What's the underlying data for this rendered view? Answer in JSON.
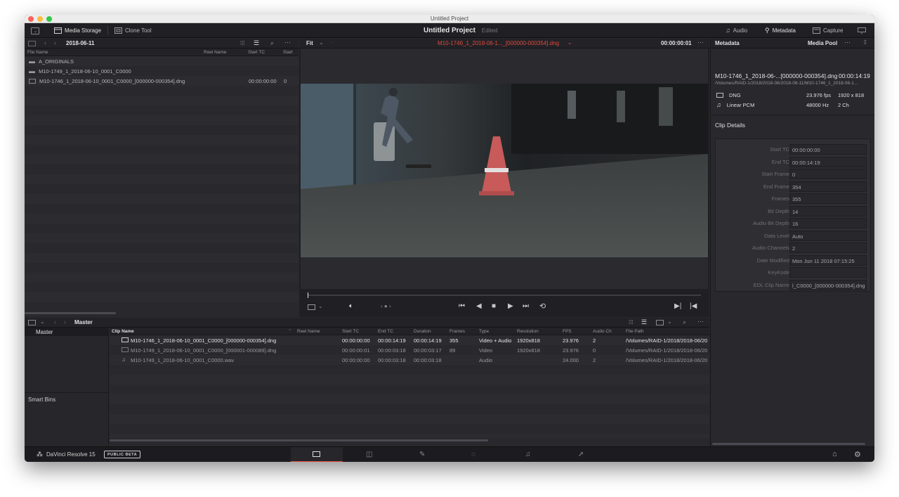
{
  "window": {
    "title": "Untitled Project"
  },
  "toolbar": {
    "media_storage": "Media Storage",
    "clone_tool": "Clone Tool",
    "project_title": "Untitled Project",
    "project_status": "Edited",
    "audio": "Audio",
    "metadata": "Metadata",
    "capture": "Capture"
  },
  "media_storage": {
    "folder": "2018-06-11",
    "columns": [
      "File Name",
      "Reel Name",
      "Start TC",
      "Start"
    ],
    "items": [
      {
        "name": "A_ORIGINALS",
        "start_tc": "",
        "start": "",
        "type": "folder"
      },
      {
        "name": "M10-1749_1_2018-06-10_0001_C0000",
        "start_tc": "",
        "start": "",
        "type": "folder"
      },
      {
        "name": "M10-1746_1_2018-06-10_0001_C0000_[000000-000354].dng",
        "start_tc": "00:00:00:00",
        "start": "0",
        "type": "clip"
      }
    ]
  },
  "viewer": {
    "zoom": "Fit",
    "clip_name": "M10-1746_1_2018-06-1..._[000000-000354].dng",
    "timecode": "00:00:00:01"
  },
  "media_pool": {
    "bin": "Master",
    "bins": [
      "Master"
    ],
    "smart_bins": "Smart Bins",
    "columns": [
      "Clip Name",
      "Reel Name",
      "Start TC",
      "End TC",
      "Duration",
      "Frames",
      "Type",
      "Resolution",
      "FPS",
      "Audio Ch",
      "File Path"
    ],
    "rows": [
      {
        "name": "M10-1746_1_2018-06-10_0001_C0000_[000000-000354].dng",
        "reel": "",
        "start_tc": "00:00:00:00",
        "end_tc": "00:00:14:19",
        "duration": "00:00:14:19",
        "frames": "355",
        "type": "Video + Audio",
        "resolution": "1920x818",
        "fps": "23.976",
        "audio_ch": "2",
        "path": "/Volumes/RAID-1/2018/2018-06/20",
        "icon": "video-clip-icon"
      },
      {
        "name": "M10-1749_1_2018-06-10_0001_C0000_[000001-000089].dng",
        "reel": "",
        "start_tc": "00:00:00:01",
        "end_tc": "00:00:03:18",
        "duration": "00:00:03:17",
        "frames": "89",
        "type": "Video",
        "resolution": "1920x818",
        "fps": "23.976",
        "audio_ch": "0",
        "path": "/Volumes/RAID-1/2018/2018-06/20",
        "icon": "video-clip-icon"
      },
      {
        "name": "M10-1749_1_2018-06-10_0001_C0000.wav",
        "reel": "",
        "start_tc": "00:00:00:00",
        "end_tc": "00:00:03:18",
        "duration": "00:00:03:18",
        "frames": "",
        "type": "Audio",
        "resolution": "",
        "fps": "24.000",
        "audio_ch": "2",
        "path": "/Volumes/RAID-1/2018/2018-06/20",
        "icon": "audio-clip-icon"
      }
    ]
  },
  "metadata": {
    "tab": "Metadata",
    "media_pool_tab": "Media Pool",
    "clip_title": "M10-1746_1_2018-06-...[000000-000354].dng",
    "clip_duration": "00:00:14:19",
    "clip_path": "/Volumes/RAID-1/2018/2018-06/2018-06-11/M10-1746_1_2018-06-1...",
    "video_codec": "DNG",
    "fps": "23.976 fps",
    "resolution": "1920 x 818",
    "audio_codec": "Linear PCM",
    "sample_rate": "48000 Hz",
    "channels": "2 Ch",
    "section": "Clip Details",
    "fields": [
      {
        "label": "Start TC",
        "value": "00:00:00:00"
      },
      {
        "label": "End TC",
        "value": "00:00:14:19"
      },
      {
        "label": "Start Frame",
        "value": "0"
      },
      {
        "label": "End Frame",
        "value": "354"
      },
      {
        "label": "Frames",
        "value": "355"
      },
      {
        "label": "Bit Depth",
        "value": "14"
      },
      {
        "label": "Audio Bit Depth",
        "value": "16"
      },
      {
        "label": "Data Level",
        "value": "Auto"
      },
      {
        "label": "Audio Channels",
        "value": "2"
      },
      {
        "label": "Date Modified",
        "value": "Mon Jun 11 2018 07:15:25"
      },
      {
        "label": "KeyKode",
        "value": ""
      },
      {
        "label": "EDL Clip Name",
        "value": "l_C0000_[000000-000354].dng"
      }
    ]
  },
  "footer": {
    "app_name": "DaVinci Resolve 15",
    "badge": "PUBLIC BETA",
    "pages": [
      "media-page-icon",
      "edit-page-icon",
      "color-page-icon",
      "fusion-page-icon",
      "fairlight-page-icon",
      "deliver-page-icon"
    ]
  }
}
